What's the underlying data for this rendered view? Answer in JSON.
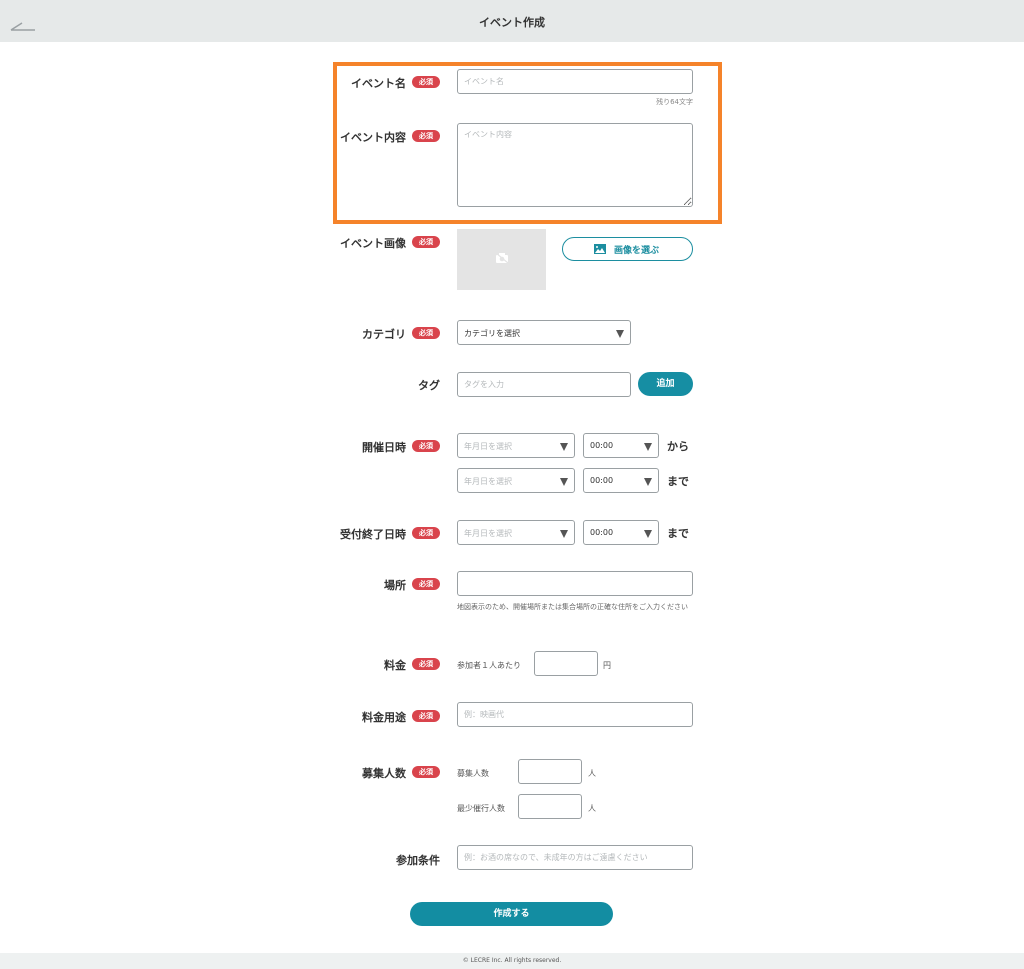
{
  "header": {
    "title": "イベント作成",
    "back_icon": "back-arrow-icon"
  },
  "required_badge": "必須",
  "fields": {
    "event_name": {
      "label": "イベント名",
      "placeholder": "イベント名",
      "counter": "残り64文字"
    },
    "event_content": {
      "label": "イベント内容",
      "placeholder": "イベント内容"
    },
    "event_image": {
      "label": "イベント画像",
      "button_label": "画像を選ぶ"
    },
    "category": {
      "label": "カテゴリ",
      "selected": "カテゴリを選択"
    },
    "tag": {
      "label": "タグ",
      "placeholder": "タグを入力",
      "add_label": "追加"
    },
    "event_datetime": {
      "label": "開催日時",
      "start": {
        "date_placeholder": "年月日を選択",
        "time": "00:00",
        "suffix": "から"
      },
      "end": {
        "date_placeholder": "年月日を選択",
        "time": "00:00",
        "suffix": "まで"
      }
    },
    "deadline": {
      "label": "受付終了日時",
      "date_placeholder": "年月日を選択",
      "time": "00:00",
      "suffix": "まで"
    },
    "place": {
      "label": "場所",
      "hint": "地図表示のため、開催場所または集合場所の正確な住所をご入力ください"
    },
    "fee": {
      "label": "料金",
      "prefix": "参加者１人あたり",
      "unit": "円"
    },
    "fee_usage": {
      "label": "料金用途",
      "placeholder": "例：映画代"
    },
    "capacity": {
      "label": "募集人数",
      "recruit_label": "募集人数",
      "recruit_unit": "人",
      "minimum_label": "最少催行人数",
      "minimum_unit": "人"
    },
    "conditions": {
      "label": "参加条件",
      "placeholder": "例：お酒の席なので、未成年の方はご遠慮ください"
    }
  },
  "submit_label": "作成する",
  "footer": {
    "copyright": "© LECRE Inc. All rights reserved."
  },
  "colors": {
    "accent": "#168ea3",
    "required": "#d9444c",
    "highlight": "#f5832a"
  }
}
